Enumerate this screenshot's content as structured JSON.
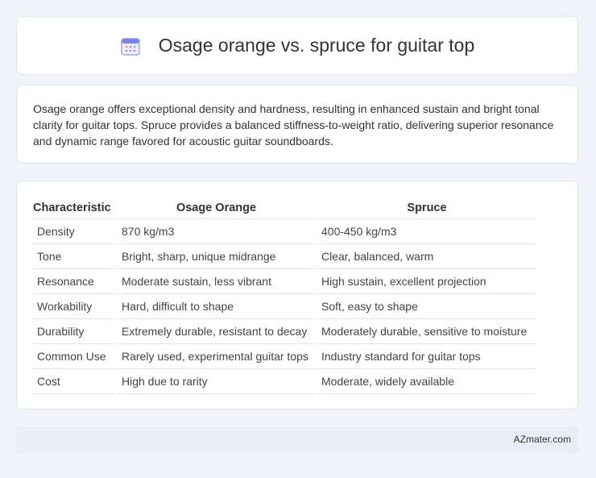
{
  "header": {
    "title": "Osage orange vs. spruce for guitar top",
    "icon": "calendar-icon"
  },
  "summary": {
    "text": "Osage orange offers exceptional density and hardness, resulting in enhanced sustain and bright tonal clarity for guitar tops. Spruce provides a balanced stiffness-to-weight ratio, delivering superior resonance and dynamic range favored for acoustic guitar soundboards."
  },
  "table": {
    "headers": [
      "Characteristic",
      "Osage Orange",
      "Spruce"
    ],
    "rows": [
      [
        "Density",
        "870 kg/m3",
        "400-450 kg/m3"
      ],
      [
        "Tone",
        "Bright, sharp, unique midrange",
        "Clear, balanced, warm"
      ],
      [
        "Resonance",
        "Moderate sustain, less vibrant",
        "High sustain, excellent projection"
      ],
      [
        "Workability",
        "Hard, difficult to shape",
        "Soft, easy to shape"
      ],
      [
        "Durability",
        "Extremely durable, resistant to decay",
        "Moderately durable, sensitive to moisture"
      ],
      [
        "Common Use",
        "Rarely used, experimental guitar tops",
        "Industry standard for guitar tops"
      ],
      [
        "Cost",
        "High due to rarity",
        "Moderate, widely available"
      ]
    ]
  },
  "footer": {
    "brand": "AZmater.com"
  }
}
